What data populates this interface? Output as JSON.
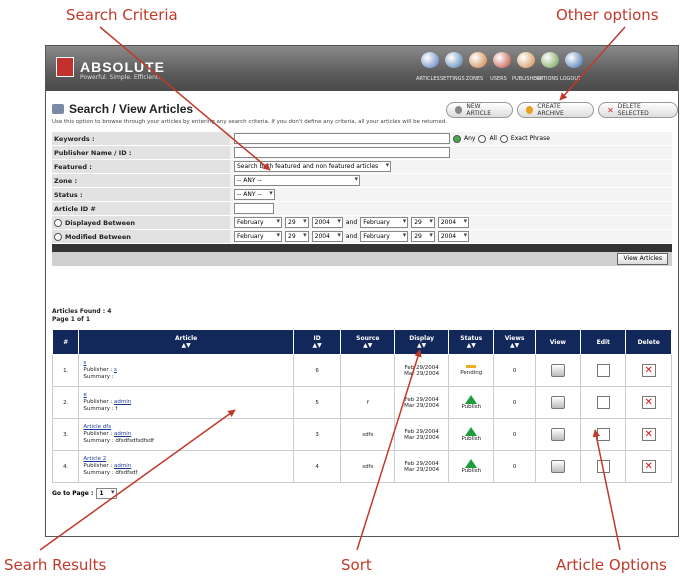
{
  "callouts": {
    "search_criteria": "Search Criteria",
    "other_options": "Other options",
    "search_results": "Searh Results",
    "sort": "Sort",
    "article_options": "Article Options"
  },
  "app": {
    "logo_text": "ABSOLUTE",
    "logo_tagline": "Powerful. Simple. Efficient.",
    "toolbar_icons": [
      {
        "label": "ARTICLES",
        "icon": "documents-icon",
        "color": "#5577bb"
      },
      {
        "label": "SETTINGS",
        "icon": "settings-icon",
        "color": "#4477aa"
      },
      {
        "label": "ZONES",
        "icon": "zones-icon",
        "color": "#cc7733"
      },
      {
        "label": "USERS",
        "icon": "users-icon",
        "color": "#bb4433"
      },
      {
        "label": "PUBLISHERS",
        "icon": "publishers-icon",
        "color": "#cc8844"
      },
      {
        "label": "OPTIONS",
        "icon": "options-icon",
        "color": "#669944"
      },
      {
        "label": "LOGOUT",
        "icon": "logout-icon",
        "color": "#3366aa"
      }
    ]
  },
  "section": {
    "title": "Search / View Articles",
    "buttons": [
      {
        "label": "NEW ARTICLE",
        "color": "#888"
      },
      {
        "label": "CREATE ARCHIVE",
        "color": "#e8a020"
      },
      {
        "label": "DELETE SELECTED",
        "color": "#d22"
      }
    ],
    "help": "Use this option to browse through your articles by entering any search criteria. If you don't define any criteria, all your articles will be returned."
  },
  "form": {
    "keywords_label": "Keywords :",
    "match_any": "Any",
    "match_all": "All",
    "match_exact": "Exact Phrase",
    "publisher_label": "Publisher Name / ID :",
    "featured_label": "Featured :",
    "featured_value": "Search both featured and non featured articles",
    "zone_label": "Zone :",
    "zone_value": "-- ANY --",
    "status_label": "Status :",
    "status_value": "-- ANY --",
    "article_id_label": "Article ID #",
    "displayed_label": "Displayed Between",
    "modified_label": "Modified Between",
    "month": "February",
    "day": "29",
    "year": "2004",
    "and": "and",
    "view_button": "View Articles"
  },
  "results": {
    "found": "Articles Found : 4",
    "page": "Page 1 of 1",
    "columns": [
      "#",
      "Article",
      "ID",
      "Source",
      "Display",
      "Status",
      "Views",
      "View",
      "Edit",
      "Delete"
    ],
    "sort_arrows": "▲▼",
    "publisher_prefix": "Publisher :",
    "summary_prefix": "Summary :",
    "rows": [
      {
        "num": "1.",
        "title": "s",
        "publisher": "s",
        "summary": "",
        "id": "6",
        "source": "",
        "display1": "Feb 29/2004",
        "display2": "Mar 29/2004",
        "status": "Pending",
        "views": "0"
      },
      {
        "num": "2.",
        "title": "e",
        "publisher": "admin",
        "summary": "f",
        "id": "5",
        "source": "f",
        "display1": "Feb 29/2004",
        "display2": "Mar 29/2004",
        "status": "Publish",
        "views": "0"
      },
      {
        "num": "3.",
        "title": "Article dfs",
        "publisher": "admin",
        "summary": "dfsdfsdfsdfsdf",
        "id": "3",
        "source": "sdfs",
        "display1": "Feb 29/2004",
        "display2": "Mar 29/2004",
        "status": "Publish",
        "views": "0"
      },
      {
        "num": "4.",
        "title": "Article 2",
        "publisher": "admin",
        "summary": "dfsdfsdf",
        "id": "4",
        "source": "sdfs",
        "display1": "Feb 29/2004",
        "display2": "Mar 29/2004",
        "status": "Publish",
        "views": "0"
      }
    ],
    "goto_label": "Go to Page :",
    "goto_value": "1"
  }
}
